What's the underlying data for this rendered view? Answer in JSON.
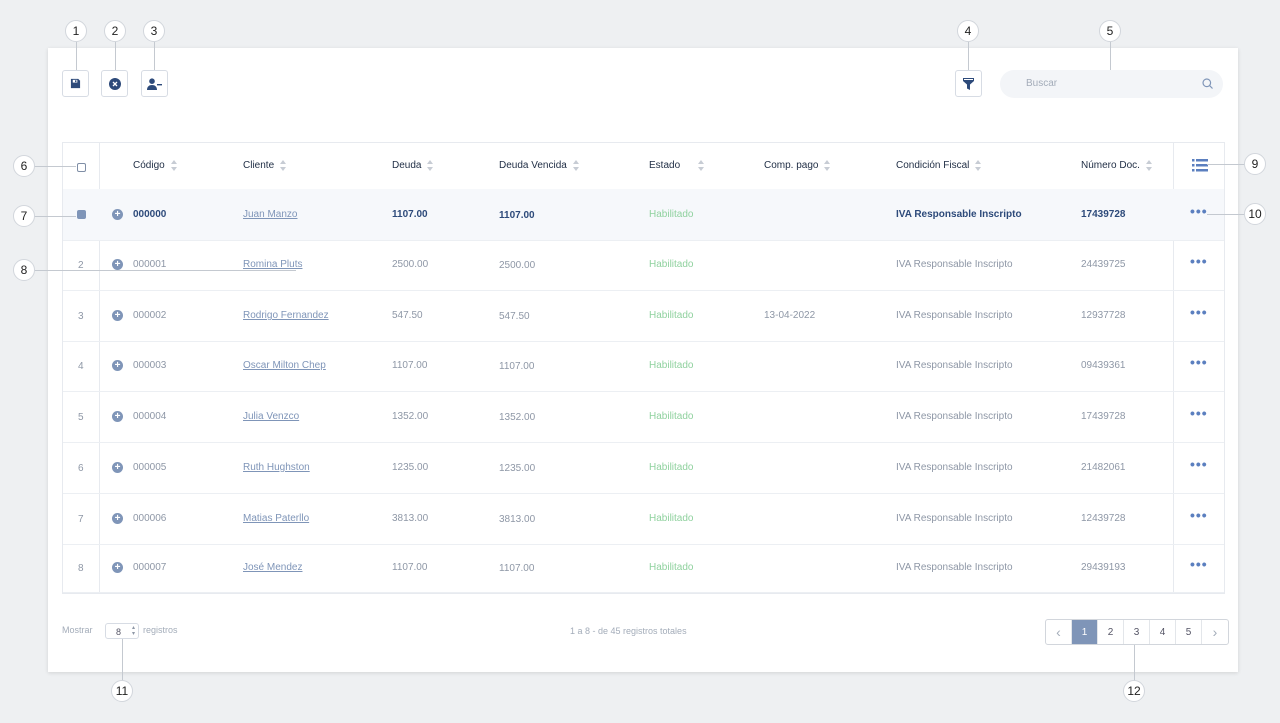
{
  "toolbar": {
    "save": "floppy-icon",
    "cancel": "close-circle-icon",
    "remove_user": "user-minus-icon",
    "filter": "filter-icon"
  },
  "search": {
    "placeholder": "Buscar"
  },
  "table": {
    "columns": [
      "Código",
      "Cliente",
      "Deuda",
      "Deuda Vencida",
      "Estado",
      "Comp. pago",
      "Condición Fiscal",
      "Número Doc."
    ],
    "rows": [
      {
        "num": "",
        "codigo": "000000",
        "cliente": "Juan Manzo",
        "deuda": "1107.00",
        "vencida": "1107.00",
        "estado": "Habilitado",
        "comp": "",
        "condicion": "IVA Responsable Inscripto",
        "doc": "17439728",
        "selected": true
      },
      {
        "num": "2",
        "codigo": "000001",
        "cliente": "Romina Pluts",
        "deuda": "2500.00",
        "vencida": "2500.00",
        "estado": "Habilitado",
        "comp": "",
        "condicion": "IVA Responsable Inscripto",
        "doc": "24439725",
        "selected": false
      },
      {
        "num": "3",
        "codigo": "000002",
        "cliente": "Rodrigo Fernandez",
        "deuda": "547.50",
        "vencida": "547.50",
        "estado": "Habilitado",
        "comp": "13-04-2022",
        "condicion": "IVA Responsable Inscripto",
        "doc": "12937728",
        "selected": false
      },
      {
        "num": "4",
        "codigo": "000003",
        "cliente": "Oscar Milton Chep",
        "deuda": "1107.00",
        "vencida": "1107.00",
        "estado": "Habilitado",
        "comp": "",
        "condicion": "IVA Responsable Inscripto",
        "doc": "09439361",
        "selected": false
      },
      {
        "num": "5",
        "codigo": "000004",
        "cliente": "Julia Venzco",
        "deuda": "1352.00",
        "vencida": "1352.00",
        "estado": "Habilitado",
        "comp": "",
        "condicion": "IVA Responsable Inscripto",
        "doc": "17439728",
        "selected": false
      },
      {
        "num": "6",
        "codigo": "000005",
        "cliente": "Ruth Hughston",
        "deuda": "1235.00",
        "vencida": "1235.00",
        "estado": "Habilitado",
        "comp": "",
        "condicion": "IVA Responsable Inscripto",
        "doc": "21482061",
        "selected": false
      },
      {
        "num": "7",
        "codigo": "000006",
        "cliente": "Matias Paterllo",
        "deuda": "3813.00",
        "vencida": "3813.00",
        "estado": "Habilitado",
        "comp": "",
        "condicion": "IVA Responsable Inscripto",
        "doc": "12439728",
        "selected": false
      },
      {
        "num": "8",
        "codigo": "000007",
        "cliente": "José Mendez",
        "deuda": "1107.00",
        "vencida": "1107.00",
        "estado": "Habilitado",
        "comp": "",
        "condicion": "IVA Responsable Inscripto",
        "doc": "29439193",
        "selected": false
      }
    ]
  },
  "footer": {
    "show_label": "Mostrar",
    "show_value": "8",
    "records_label": "registros",
    "summary": "1 a 8 - de 45 registros totales",
    "pages": [
      "1",
      "2",
      "3",
      "4",
      "5"
    ],
    "prev": "‹",
    "next": "›"
  },
  "callouts": [
    "1",
    "2",
    "3",
    "4",
    "5",
    "6",
    "7",
    "8",
    "9",
    "10",
    "11",
    "12"
  ],
  "colors": {
    "accent": "#7f95b8",
    "status_ok": "#8fd19e",
    "dark": "#2d4a7a"
  }
}
